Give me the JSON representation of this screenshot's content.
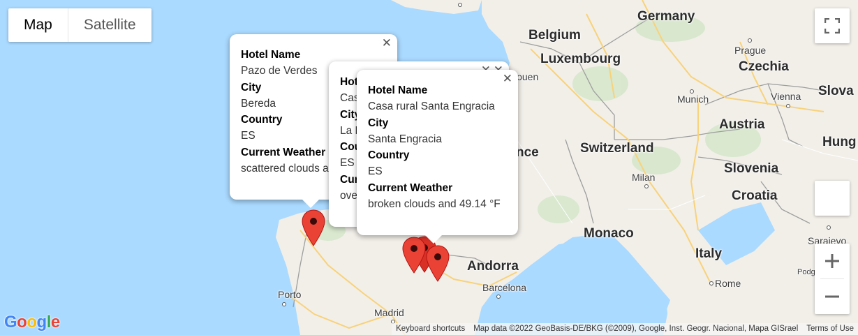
{
  "map_type": {
    "map_label": "Map",
    "satellite_label": "Satellite"
  },
  "labels": {
    "countries": [
      "Belgium",
      "Germany",
      "Luxembourg",
      "Czechia",
      "Slova",
      "Austria",
      "Hung",
      "Switzerland",
      "Slovenia",
      "Croatia",
      "Monaco",
      "Italy",
      "Andorra",
      "nce"
    ],
    "cities": [
      "Prague",
      "Vienna",
      "Munich",
      "Milan",
      "Sarajevo",
      "Rome",
      "Barcelona",
      "Madrid",
      "Porto",
      "Podgorica",
      "Rouen"
    ]
  },
  "info_windows": [
    {
      "hotel_name_label": "Hotel Name",
      "hotel_name": "Pazo de Verdes",
      "city_label": "City",
      "city": "Bereda",
      "country_label": "Country",
      "country": "ES",
      "weather_label": "Current Weather",
      "weather": "scattered clouds a"
    },
    {
      "hotel_name_label": "Hot",
      "hotel_name": "Cas",
      "city_label": "City",
      "city": "La F",
      "country_label": "Cou",
      "country": "ES",
      "weather_label": "Cur",
      "weather": "ove"
    },
    {
      "hotel_name_label": "Hotel Name",
      "hotel_name": "Casa rural Santa Engracia",
      "city_label": "City",
      "city": "Santa Engracia",
      "country_label": "Country",
      "country": "ES",
      "weather_label": "Current Weather",
      "weather": "broken clouds and 49.14 °F"
    }
  ],
  "footer": {
    "keyboard": "Keyboard shortcuts",
    "attribution": "Map data ©2022 GeoBasis-DE/BKG (©2009), Google, Inst. Geogr. Nacional, Mapa GISrael",
    "terms": "Terms of Use"
  },
  "logo": "Google",
  "icons": {
    "fullscreen": "fullscreen-icon",
    "zoom_in": "plus-icon",
    "zoom_out": "minus-icon",
    "close": "close-icon",
    "marker": "map-marker-icon"
  },
  "colors": {
    "water": "#aadaff",
    "land": "#f2efe9",
    "marker": "#ea4335",
    "border": "#9e9e9e"
  }
}
